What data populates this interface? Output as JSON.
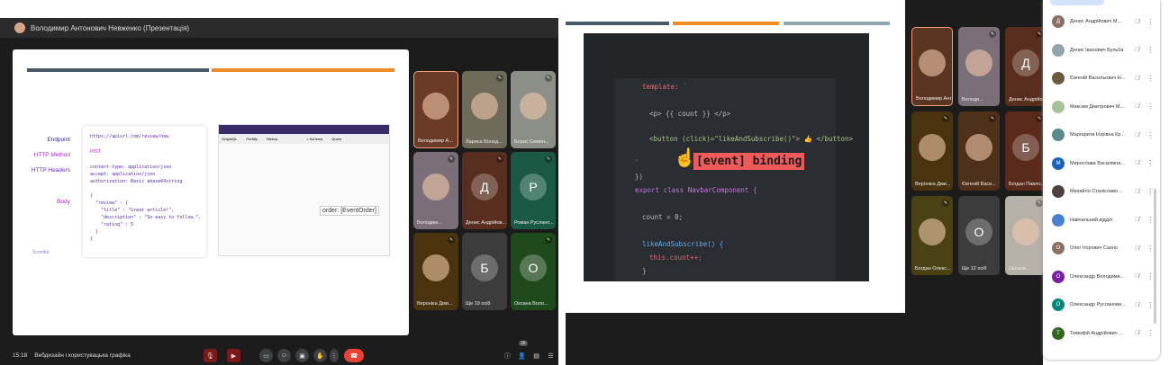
{
  "left": {
    "presenter": "Володимир Антонович Невженко (Презентація)",
    "slide": {
      "labels": [
        "Endpoint",
        "HTTP Method",
        "HTTP Headers",
        "Body"
      ],
      "endpoint": "https://apiurl.com/review/new",
      "method": "POST",
      "headers": "content-type: application/json\naccept: application/json\nauthorization: Basic abase64string",
      "body": "{\n  \"review\" : {\n    \"title\" : \"Great article!\",\n    \"description\" : \"So easy to follow.\",\n    \"rating\" : 5\n  }\n}",
      "graphiql_tab": "GraphiQL",
      "prettify": "Prettify",
      "history": "History",
      "schema": "< Schema",
      "query": "Query",
      "tooltip": "order: [EventOrder]",
      "logo": "Scrimba"
    },
    "tiles": [
      {
        "name": "Володимир А...",
        "initial": "",
        "color": "#6b3b28",
        "mic": ""
      },
      {
        "name": "Лариса Волод...",
        "initial": "",
        "color": "#6f6a5a",
        "mic": "✎"
      },
      {
        "name": "Борис Семен...",
        "initial": "",
        "color": "#8c8f88",
        "mic": "✎"
      },
      {
        "name": "Володим...",
        "initial": "",
        "color": "#7a6e78",
        "mic": "✎"
      },
      {
        "name": "Денис Андрійов...",
        "initial": "Д",
        "color": "#5a2e1e",
        "mic": "✎"
      },
      {
        "name": "Роман Руслано...",
        "initial": "Р",
        "color": "#1a5a44",
        "mic": "✎"
      },
      {
        "name": "Вероніка Дми...",
        "initial": "",
        "color": "#4a3410",
        "mic": "✎"
      },
      {
        "name": "Ще 19 осіб",
        "initial": "Б",
        "color": "#3c3c3c",
        "mic": ""
      },
      {
        "name": "Оксана Воло...",
        "initial": "О",
        "color": "#1f4a1c",
        "mic": "✎"
      }
    ],
    "bottom": {
      "time": "15:18",
      "meeting": "Вебдизайн і користувацька графіка",
      "badge": "38"
    }
  },
  "middle": {
    "code": [
      "template: `",
      "<p> {{ count }} </p>",
      "<button (click)=\"likeAndSubscribe()\"> 👍 </button>",
      "`",
      "})",
      "export class NavbarComponent {",
      "count = 0;",
      "likeAndSubscribe() {",
      "this.count++;",
      "}"
    ],
    "callout": "[event] binding"
  },
  "right": {
    "tiles": [
      {
        "name": "Володимир Ант...",
        "initial": "",
        "color": "#5a3622",
        "mic": ""
      },
      {
        "name": "Володи...",
        "initial": "",
        "color": "#7a6e78",
        "mic": "✎"
      },
      {
        "name": "Денис Андрійов...",
        "initial": "Д",
        "color": "#5a2e1e",
        "mic": "✎"
      },
      {
        "name": "Вероніка Дми...",
        "initial": "",
        "color": "#4a3410",
        "mic": "✎"
      },
      {
        "name": "Євгеній Васи...",
        "initial": "",
        "color": "#4f3018",
        "mic": "✎"
      },
      {
        "name": "Богдан Павло...",
        "initial": "Б",
        "color": "#5a2a1a",
        "mic": "✎"
      },
      {
        "name": "Богдан Олекс...",
        "initial": "",
        "color": "#4a4214",
        "mic": "✎"
      },
      {
        "name": "Ще 12 осіб",
        "initial": "О",
        "color": "#3c3c3c",
        "mic": ""
      },
      {
        "name": "Оксана...",
        "initial": "",
        "color": "#b5b0a8",
        "mic": "✎"
      }
    ]
  },
  "participants": [
    {
      "name": "Денис Андрійович М...",
      "initial": "Д",
      "color": "#8d6e63"
    },
    {
      "name": "Денис Іванович Бульба",
      "initial": "",
      "color": "#90a4ae"
    },
    {
      "name": "Євгеній Васильович Н...",
      "initial": "",
      "color": "#6d5a40"
    },
    {
      "name": "Максим Дмитрович М...",
      "initial": "",
      "color": "#a5c39a"
    },
    {
      "name": "Маргарита Ігорівна Кр...",
      "initial": "",
      "color": "#5a8a8a"
    },
    {
      "name": "Мирослава Василівна...",
      "initial": "М",
      "color": "#1565c0"
    },
    {
      "name": "Михайло Станіславо...",
      "initial": "",
      "color": "#4e4040"
    },
    {
      "name": "Навчальний відділ",
      "initial": "",
      "color": "#4a7fd6"
    },
    {
      "name": "Олег Ігорович Сахно",
      "initial": "О",
      "color": "#8d6e63"
    },
    {
      "name": "Олександр Володими...",
      "initial": "О",
      "color": "#7b1fa2"
    },
    {
      "name": "Олександр Русланови...",
      "initial": "О",
      "color": "#00897b"
    },
    {
      "name": "Тимофій Андрійович С...",
      "initial": "Т",
      "color": "#33691e"
    }
  ],
  "colors": {
    "accent_orange": "#f08a24",
    "bar_dark": "#455a64",
    "callout_red": "#f05a5a",
    "end_call": "#ea4335"
  }
}
